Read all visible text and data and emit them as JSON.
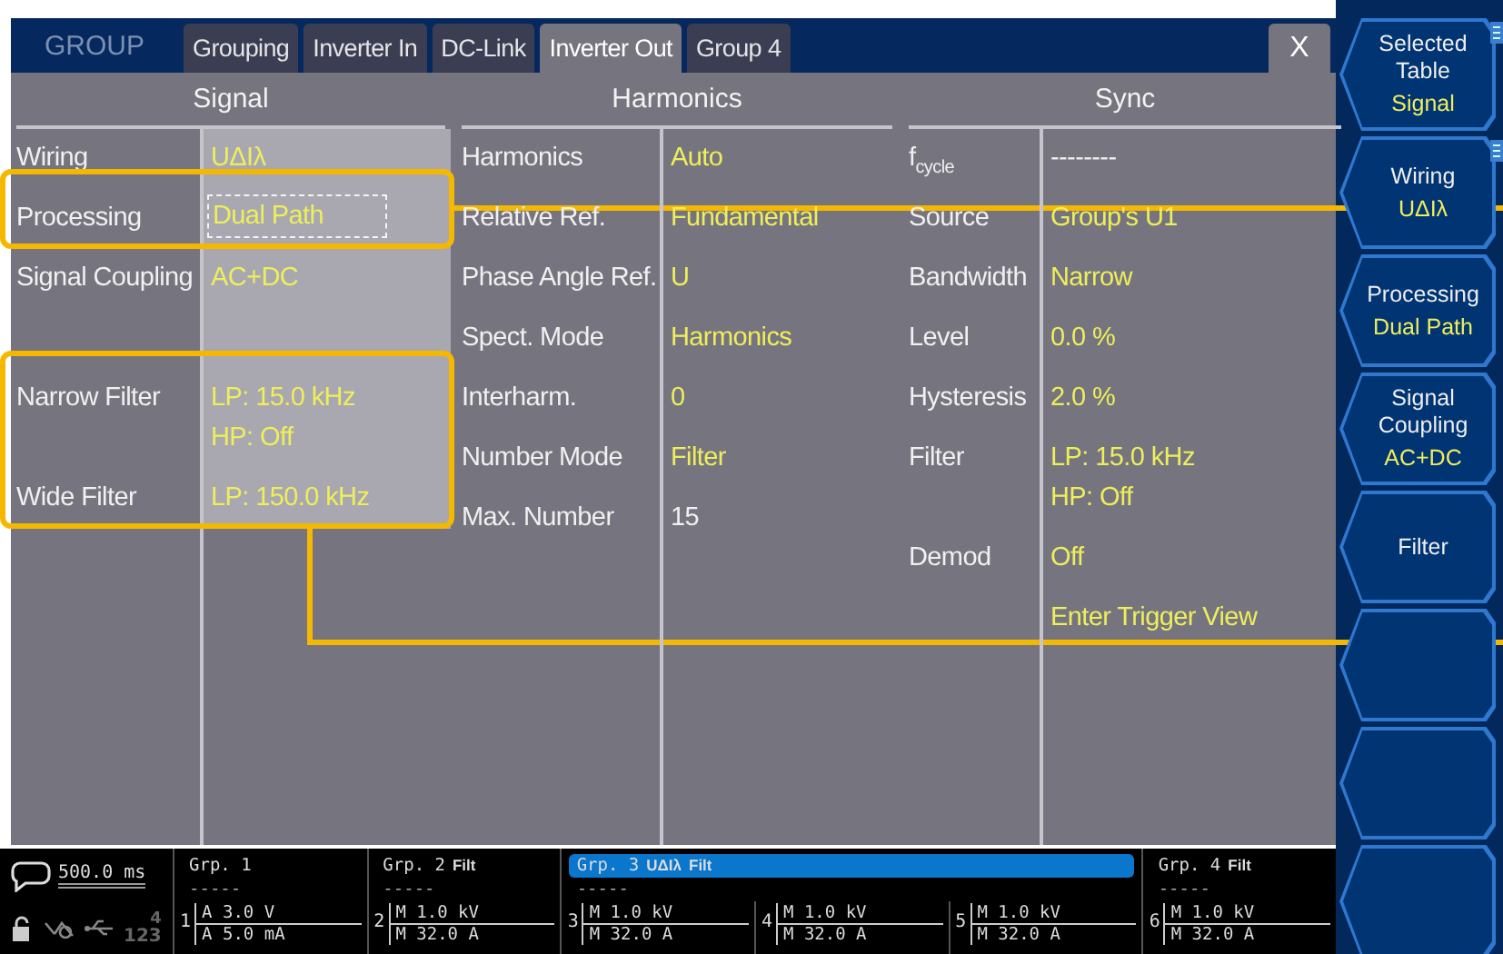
{
  "header": {
    "title": "GROUP",
    "close": "X"
  },
  "tabs": [
    {
      "label": "Grouping",
      "selected": false
    },
    {
      "label": "Inverter In",
      "selected": false
    },
    {
      "label": "DC-Link",
      "selected": false
    },
    {
      "label": "Inverter Out",
      "selected": true
    },
    {
      "label": "Group 4",
      "selected": false
    }
  ],
  "sections": [
    {
      "title": "Signal",
      "selected": true,
      "rows": [
        {
          "label": "Wiring",
          "value": [
            "UΔIλ"
          ],
          "editable": true,
          "focused": false
        },
        {
          "label": "Processing",
          "value": [
            "Dual Path"
          ],
          "editable": true,
          "focused": true
        },
        {
          "label": "Signal Coupling",
          "value": [
            "AC+DC"
          ],
          "editable": true,
          "focused": false
        },
        {
          "kind": "spacer"
        },
        {
          "label": "Narrow Filter",
          "value": [
            "LP: 15.0 kHz",
            "HP: Off"
          ],
          "editable": true,
          "focused": false
        },
        {
          "label": "Wide Filter",
          "value": [
            "LP: 150.0 kHz"
          ],
          "editable": true,
          "focused": false
        }
      ]
    },
    {
      "title": "Harmonics",
      "selected": false,
      "rows": [
        {
          "label": "Harmonics",
          "value": [
            "Auto"
          ],
          "editable": true,
          "focused": false
        },
        {
          "label": "Relative Ref.",
          "value": [
            "Fundamental"
          ],
          "editable": true,
          "focused": false
        },
        {
          "label": "Phase Angle Ref.",
          "value": [
            "U"
          ],
          "editable": true,
          "focused": false
        },
        {
          "label": "Spect. Mode",
          "value": [
            "Harmonics"
          ],
          "editable": true,
          "focused": false
        },
        {
          "label": "Interharm.",
          "value": [
            "0"
          ],
          "editable": true,
          "focused": false
        },
        {
          "label": "Number Mode",
          "value": [
            "Filter"
          ],
          "editable": true,
          "focused": false
        },
        {
          "label": "Max. Number",
          "value": [
            "15"
          ],
          "editable": false,
          "focused": false
        }
      ]
    },
    {
      "title": "Sync",
      "selected": false,
      "rows": [
        {
          "label": "f$_{cycle}$",
          "value": [
            "--------"
          ],
          "editable": false,
          "focused": false
        },
        {
          "label": "Source",
          "value": [
            "Group's U1"
          ],
          "editable": true,
          "focused": false
        },
        {
          "label": "Bandwidth",
          "value": [
            "Narrow"
          ],
          "editable": true,
          "focused": false
        },
        {
          "label": "Level",
          "value": [
            "0.0 %"
          ],
          "editable": true,
          "focused": false
        },
        {
          "label": "Hysteresis",
          "value": [
            "2.0 %"
          ],
          "editable": true,
          "focused": false
        },
        {
          "label": "Filter",
          "value": [
            "LP: 15.0 kHz",
            "HP: Off"
          ],
          "editable": true,
          "focused": false
        },
        {
          "label": "Demod",
          "value": [
            "Off"
          ],
          "editable": true,
          "focused": false
        },
        {
          "value": [
            "Enter Trigger View"
          ],
          "editable": true,
          "focused": false
        }
      ]
    }
  ],
  "softkeys": [
    {
      "kind": "key",
      "label": "Selected Table",
      "value": "Signal",
      "has_menu": true
    },
    {
      "kind": "key",
      "label": "Wiring",
      "value": "UΔIλ",
      "has_menu": true
    },
    {
      "kind": "key",
      "label": "Processing",
      "value": "Dual Path",
      "has_menu": false
    },
    {
      "kind": "key",
      "label": "Signal Coupling",
      "value": "AC+DC",
      "has_menu": false
    },
    {
      "kind": "key",
      "label": "Filter",
      "has_menu": false
    },
    {
      "kind": "blank"
    },
    {
      "kind": "blank"
    },
    {
      "kind": "blank"
    }
  ],
  "status_bar": {
    "time": "500.0 ms",
    "ports": [
      "4",
      "123"
    ],
    "groups": [
      {
        "name": "Grp. 1",
        "dashes": "-----",
        "selected": false,
        "channels": [
          {
            "number": "1",
            "voltage": "A 3.0 V",
            "current": "A 5.0 mA"
          }
        ]
      },
      {
        "name": "Grp. 2",
        "tags": [
          "Filt"
        ],
        "dashes": "-----",
        "selected": false,
        "channels": [
          {
            "number": "2",
            "voltage": "M 1.0 kV",
            "current": "M 32.0 A"
          }
        ]
      },
      {
        "name": "Grp. 3",
        "tags": [
          "UΔIλ",
          "Filt"
        ],
        "dashes": "-----",
        "selected": true,
        "channels": [
          {
            "number": "3",
            "voltage": "M 1.0 kV",
            "current": "M 32.0 A"
          },
          {
            "number": "4",
            "voltage": "M 1.0 kV",
            "current": "M 32.0 A"
          },
          {
            "number": "5",
            "voltage": "M 1.0 kV",
            "current": "M 32.0 A"
          }
        ]
      },
      {
        "name": "Grp. 4",
        "tags": [
          "Filt"
        ],
        "dashes": "-----",
        "selected": false,
        "channels": [
          {
            "number": "6",
            "voltage": "M 1.0 kV",
            "current": "M 32.0 A"
          }
        ]
      }
    ]
  },
  "annotations": [
    {
      "kind": "frame"
    },
    {
      "kind": "frame"
    },
    {
      "kind": "line"
    },
    {
      "kind": "line"
    }
  ]
}
